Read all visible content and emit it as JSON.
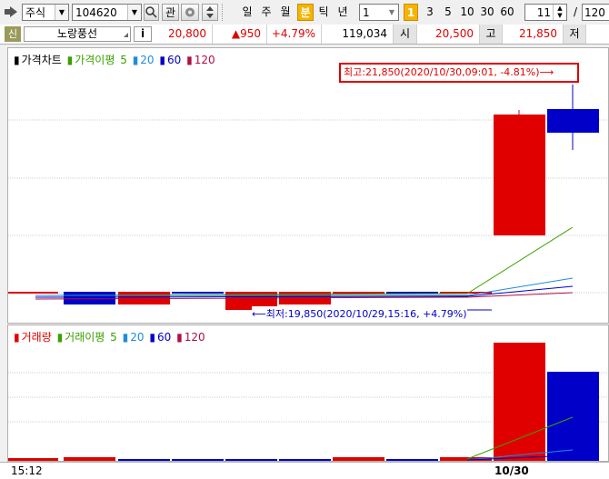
{
  "toolbar": {
    "market": "주식",
    "code": "104620",
    "gwan_label": "관",
    "periods": [
      "일",
      "주",
      "월",
      "분",
      "틱",
      "년"
    ],
    "active_period": "분",
    "interval_value": "1",
    "intervals": [
      "1",
      "3",
      "5",
      "10",
      "30",
      "60"
    ],
    "active_interval": "1",
    "count_value": "11",
    "slash": "/",
    "total_value": "120"
  },
  "info": {
    "badge": "신",
    "name": "노랑풍선",
    "i_button": "i",
    "price": "20,800",
    "change": "▲950",
    "change_pct": "+4.79%",
    "volume": "119,034",
    "open_label": "시",
    "open": "20,500",
    "high_label": "고",
    "high": "21,850",
    "low_label": "저"
  },
  "price_panel": {
    "legend_main": "가격차트",
    "legend_ma_label": "가격이평",
    "ma": [
      "5",
      "20",
      "60",
      "120"
    ],
    "high_annotation": "최고:21,850(2020/10/30,09:01, -4.81%)⟶",
    "low_annotation": "⟵최저:19,850(2020/10/29,15:16, +4.79%)"
  },
  "volume_panel": {
    "legend_main": "거래량",
    "legend_ma_label": "거래이평",
    "ma": [
      "5",
      "20",
      "60",
      "120"
    ]
  },
  "footer": {
    "left_time": "15:12",
    "date_label": "10/30"
  },
  "colors": {
    "up": "#e00000",
    "down": "#0000c8",
    "ma5": "#3aa000",
    "ma20": "#1e8cdc",
    "ma60": "#0000c8",
    "ma120": "#b01040",
    "active_tab": "#f5b400"
  }
}
